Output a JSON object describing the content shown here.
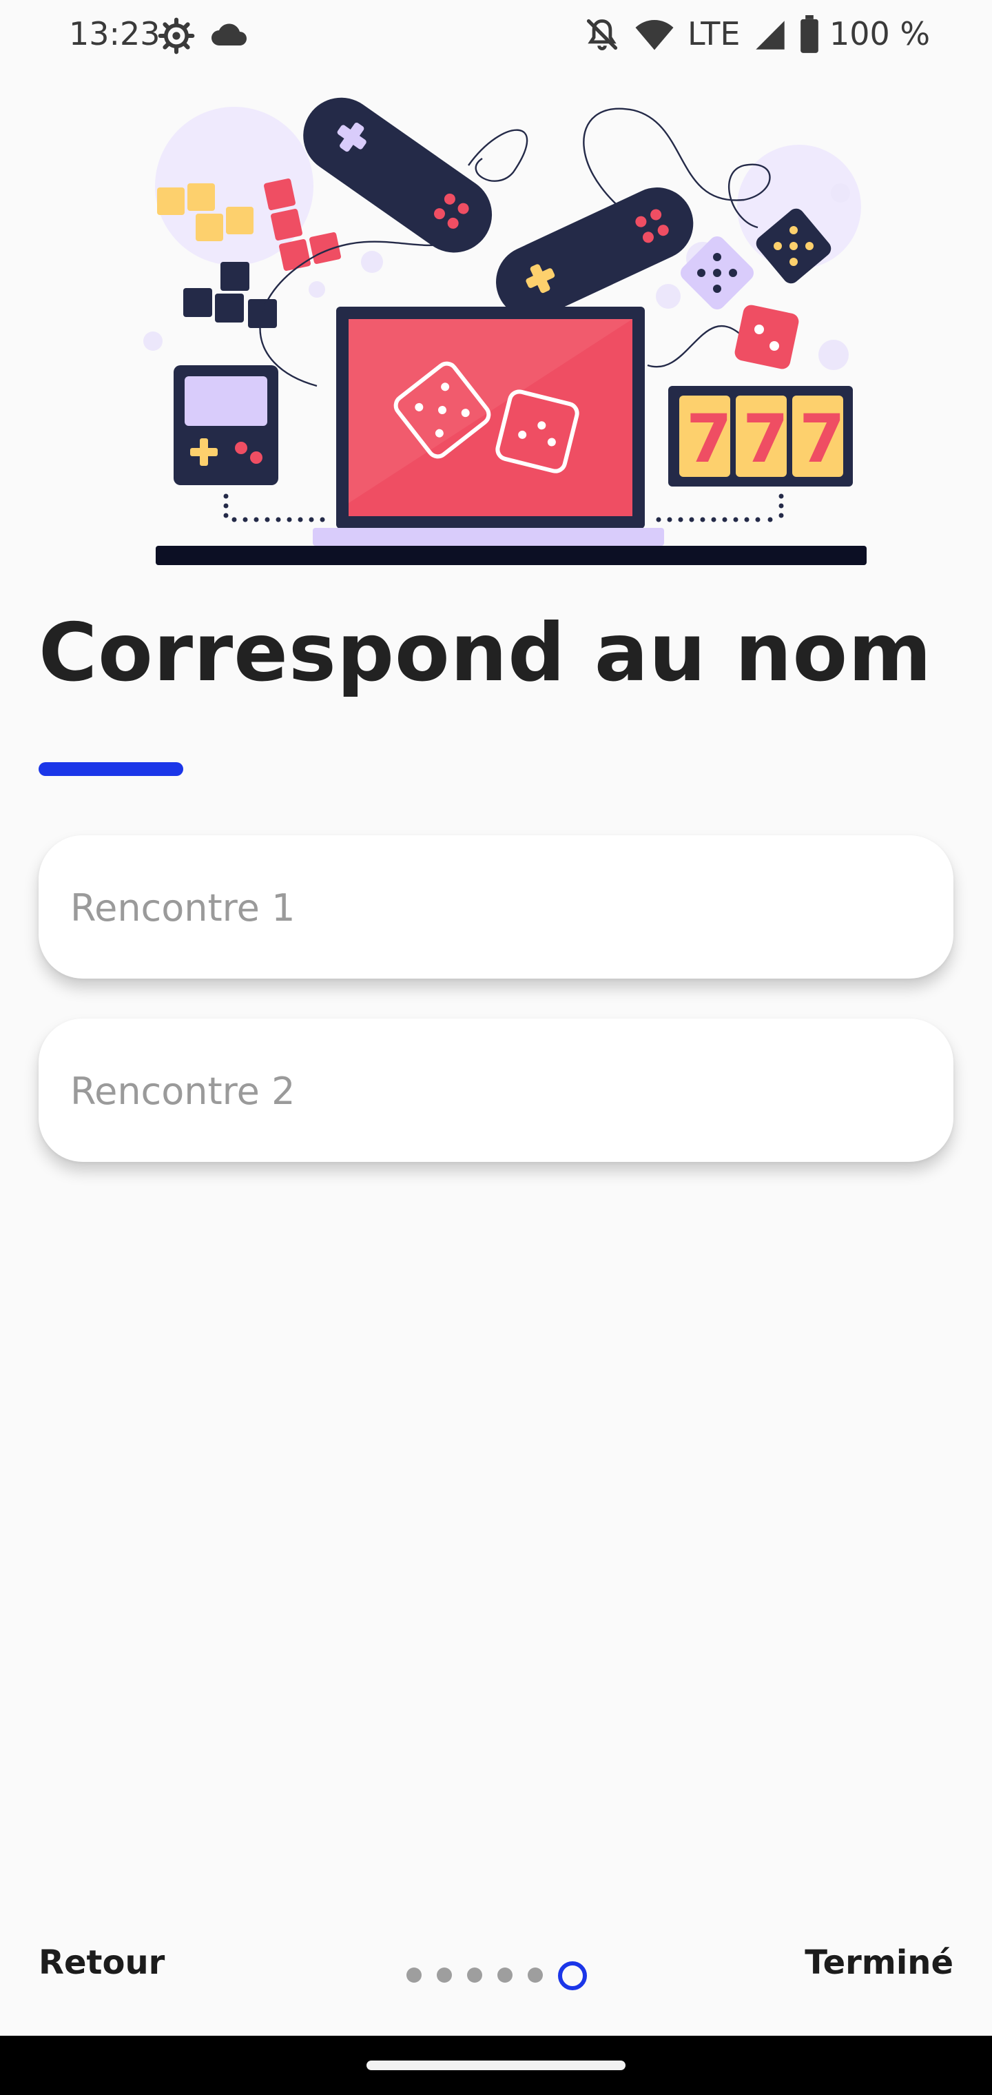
{
  "status_bar": {
    "time": "13:23",
    "network": "LTE",
    "battery": "100 %",
    "icons": [
      "settings-icon",
      "cloud-icon",
      "notifications-off-icon",
      "wifi-icon",
      "signal-icon",
      "battery-icon"
    ]
  },
  "main": {
    "title": "Correspond au nom",
    "fields": [
      {
        "placeholder": "Rencontre 1",
        "value": ""
      },
      {
        "placeholder": "Rencontre 2",
        "value": ""
      }
    ]
  },
  "footer": {
    "back_label": "Retour",
    "done_label": "Terminé",
    "page_indicator": {
      "total": 6,
      "current": 6
    }
  },
  "colors": {
    "accent": "#1b36e8",
    "background": "#fafafa",
    "illustration_red": "#ef4e63",
    "illustration_navy": "#242a48",
    "illustration_yellow": "#fdd06d",
    "illustration_lavender": "#d9ccfb"
  }
}
